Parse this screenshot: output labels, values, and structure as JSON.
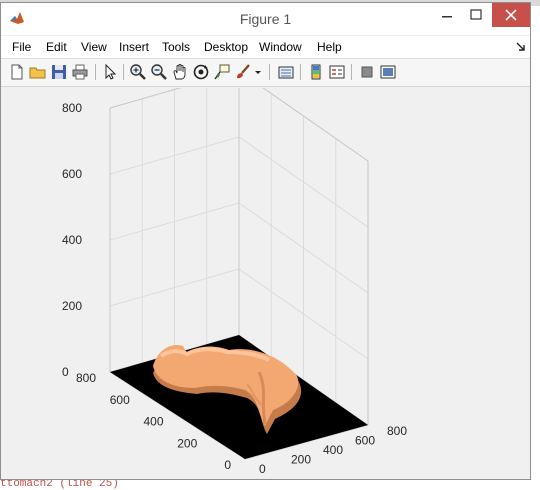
{
  "window": {
    "title": "Figure 1",
    "menu": [
      "File",
      "Edit",
      "View",
      "Insert",
      "Tools",
      "Desktop",
      "Window",
      "Help"
    ]
  },
  "toolbar": {
    "icons": [
      "new-figure-icon",
      "open-file-icon",
      "save-icon",
      "print-icon",
      "select-arrow-icon",
      "zoom-in-icon",
      "zoom-out-icon",
      "pan-hand-icon",
      "rotate-3d-icon",
      "data-cursor-icon",
      "brush-icon",
      "link-plot-icon",
      "colorbar-icon",
      "legend-icon",
      "hide-plot-tools-icon",
      "show-plot-tools-icon"
    ]
  },
  "behind": {
    "fragment": "ttomach2 (line 25)"
  },
  "chart_data": {
    "type": "surface",
    "description_colors": {
      "surface": "#f2a06a",
      "floor": "#000000"
    },
    "z_ticks": [
      "0",
      "200",
      "400",
      "600",
      "800"
    ],
    "x_ticks": [
      "0",
      "200",
      "400",
      "600",
      "800"
    ],
    "y_ticks": [
      "0",
      "200",
      "400",
      "600",
      "800"
    ],
    "zlim": [
      0,
      800
    ],
    "xlim": [
      0,
      800
    ],
    "ylim": [
      0,
      800
    ],
    "grid": true
  }
}
